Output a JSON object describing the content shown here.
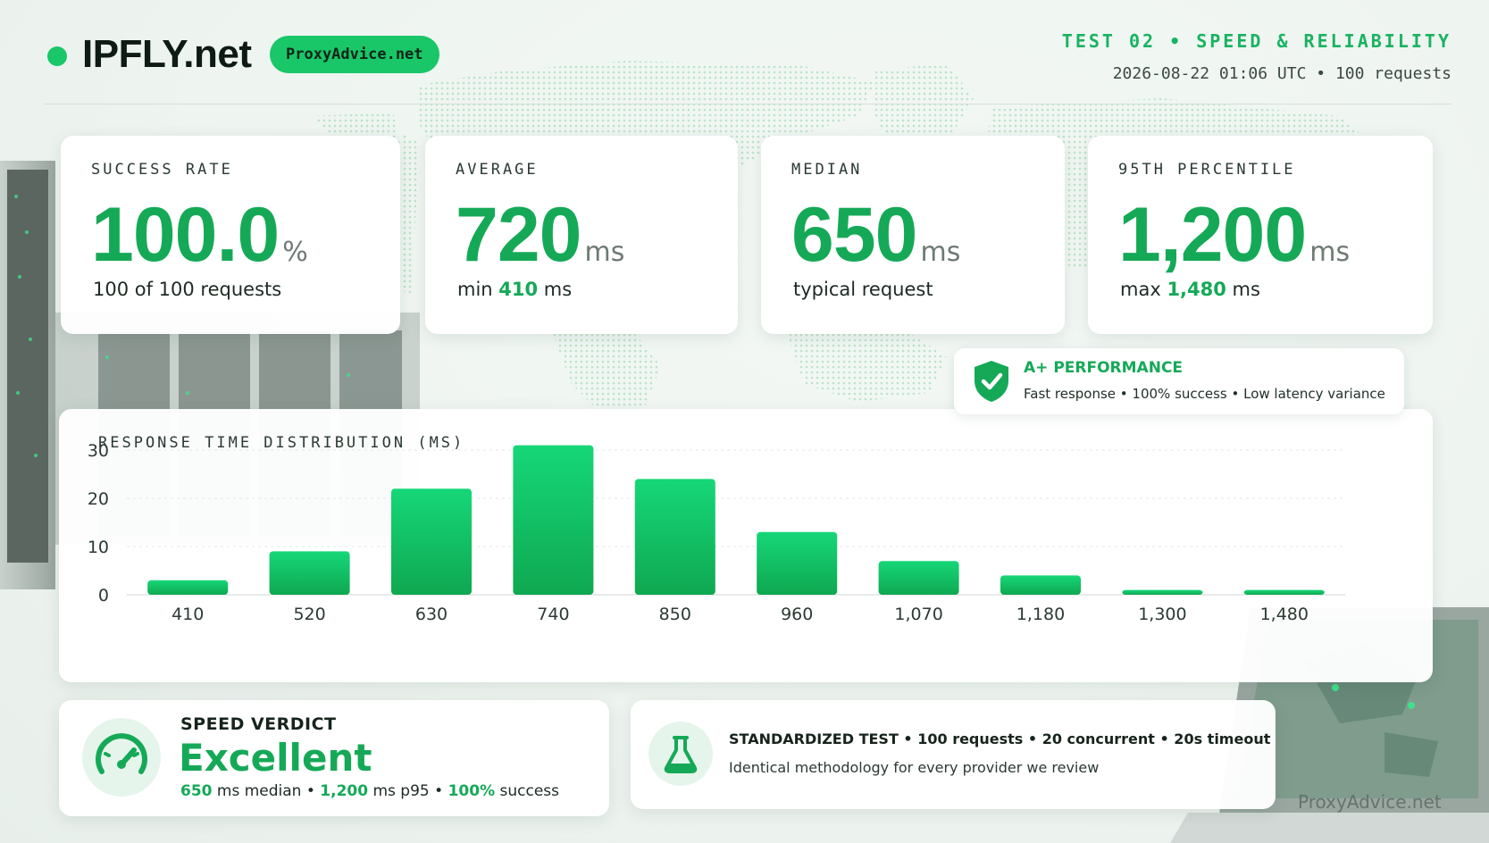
{
  "header": {
    "brand": "IPFLY.net",
    "badge": "ProxyAdvice.net",
    "test_label": "TEST 02 • SPEED & RELIABILITY",
    "test_meta": "2026-08-22 01:06 UTC • 100 requests"
  },
  "stats": [
    {
      "label": "SUCCESS RATE",
      "value": "100.0",
      "unit": "%",
      "sub_pre": "100 of 100 requests",
      "sub_hl": "",
      "sub_post": ""
    },
    {
      "label": "AVERAGE",
      "value": "720",
      "unit": "ms",
      "sub_pre": "min ",
      "sub_hl": "410",
      "sub_post": " ms"
    },
    {
      "label": "MEDIAN",
      "value": "650",
      "unit": "ms",
      "sub_pre": "typical request",
      "sub_hl": "",
      "sub_post": ""
    },
    {
      "label": "95TH PERCENTILE",
      "value": "1,200",
      "unit": "ms",
      "sub_pre": "max ",
      "sub_hl": "1,480",
      "sub_post": " ms"
    }
  ],
  "performance": {
    "title": "A+ PERFORMANCE",
    "sub": "Fast response  •  100% success  •  Low latency variance",
    "icon": "shield-check-icon"
  },
  "chart_data": {
    "type": "bar",
    "title": "RESPONSE TIME DISTRIBUTION (MS)",
    "categories": [
      "410",
      "520",
      "630",
      "740",
      "850",
      "960",
      "1,070",
      "1,180",
      "1,300",
      "1,480"
    ],
    "values": [
      3,
      9,
      22,
      31,
      24,
      13,
      7,
      4,
      1,
      1
    ],
    "y_ticks": [
      "0",
      "10",
      "20",
      "30"
    ],
    "ylim": [
      0,
      30
    ],
    "grid": true,
    "bar_color": "#14b85e"
  },
  "verdict": {
    "label": "SPEED VERDICT",
    "value": "Excellent",
    "m1": "650",
    "t1": " ms median",
    "m2": "1,200",
    "t2": " ms p95",
    "m3": "100%",
    "t3": " success",
    "icon": "speedometer-icon"
  },
  "methodology": {
    "title": "STANDARDIZED TEST  •  100 requests  •  20 concurrent  •  20s timeout",
    "sub": "Identical methodology for every provider we review",
    "icon": "flask-icon"
  },
  "watermark": "ProxyAdvice.net",
  "colors": {
    "accent": "#15a957",
    "pill": "#19c768",
    "bar": "#14b85e"
  }
}
